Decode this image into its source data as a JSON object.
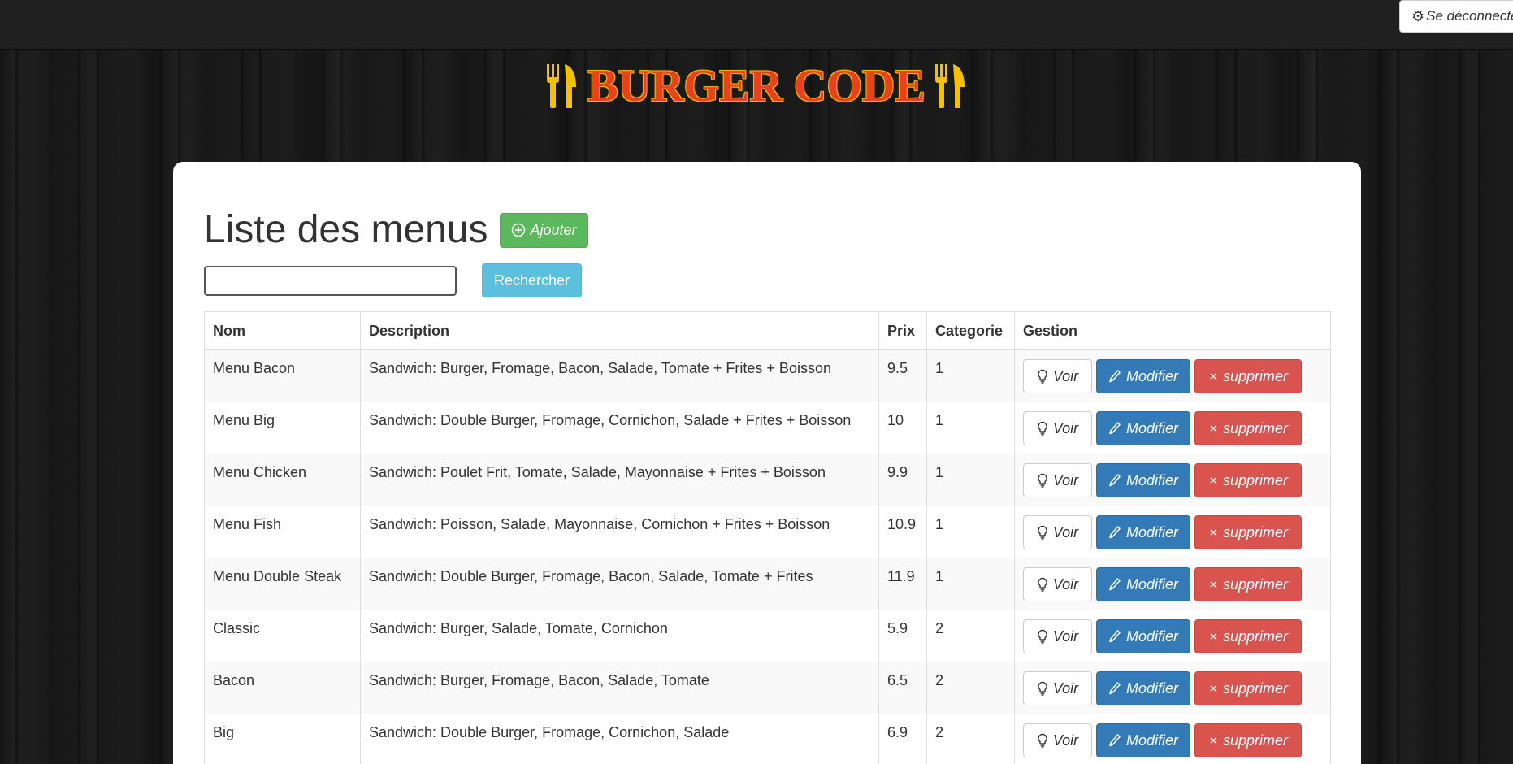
{
  "header": {
    "logout_label": "Se déconnecter",
    "brand_title": "BURGER CODE"
  },
  "main": {
    "title": "Liste des menus",
    "add_label": "Ajouter",
    "search_placeholder": "",
    "search_value": "",
    "search_button": "Rechercher"
  },
  "table": {
    "headers": {
      "nom": "Nom",
      "description": "Description",
      "prix": "Prix",
      "categorie": "Categorie",
      "gestion": "Gestion"
    },
    "rows": [
      {
        "nom": "Menu Bacon",
        "description": "Sandwich: Burger, Fromage, Bacon, Salade, Tomate + Frites + Boisson",
        "prix": "9.5",
        "categorie": "1"
      },
      {
        "nom": "Menu Big",
        "description": "Sandwich: Double Burger, Fromage, Cornichon, Salade + Frites + Boisson",
        "prix": "10",
        "categorie": "1"
      },
      {
        "nom": "Menu Chicken",
        "description": "Sandwich: Poulet Frit, Tomate, Salade, Mayonnaise + Frites + Boisson",
        "prix": "9.9",
        "categorie": "1"
      },
      {
        "nom": "Menu Fish",
        "description": "Sandwich: Poisson, Salade, Mayonnaise, Cornichon + Frites + Boisson",
        "prix": "10.9",
        "categorie": "1"
      },
      {
        "nom": "Menu Double Steak",
        "description": "Sandwich: Double Burger, Fromage, Bacon, Salade, Tomate + Frites",
        "prix": "11.9",
        "categorie": "1"
      },
      {
        "nom": "Classic",
        "description": "Sandwich: Burger, Salade, Tomate, Cornichon",
        "prix": "5.9",
        "categorie": "2"
      },
      {
        "nom": "Bacon",
        "description": "Sandwich: Burger, Fromage, Bacon, Salade, Tomate",
        "prix": "6.5",
        "categorie": "2"
      },
      {
        "nom": "Big",
        "description": "Sandwich: Double Burger, Fromage, Cornichon, Salade",
        "prix": "6.9",
        "categorie": "2"
      }
    ],
    "actions": {
      "view": "Voir",
      "edit": "Modifier",
      "delete": "supprimer"
    }
  },
  "icons": {
    "logout": "gear-icon",
    "brand": "cutlery-icon",
    "add": "plus-circle-icon",
    "view": "lightbulb-icon",
    "edit": "pencil-icon",
    "delete": "close-icon"
  },
  "colors": {
    "add": "#5cb85c",
    "search": "#5bc0de",
    "edit": "#337ab7",
    "delete": "#d9534f",
    "brand_text": "#e7411d",
    "brand_accent": "#f5c000"
  }
}
